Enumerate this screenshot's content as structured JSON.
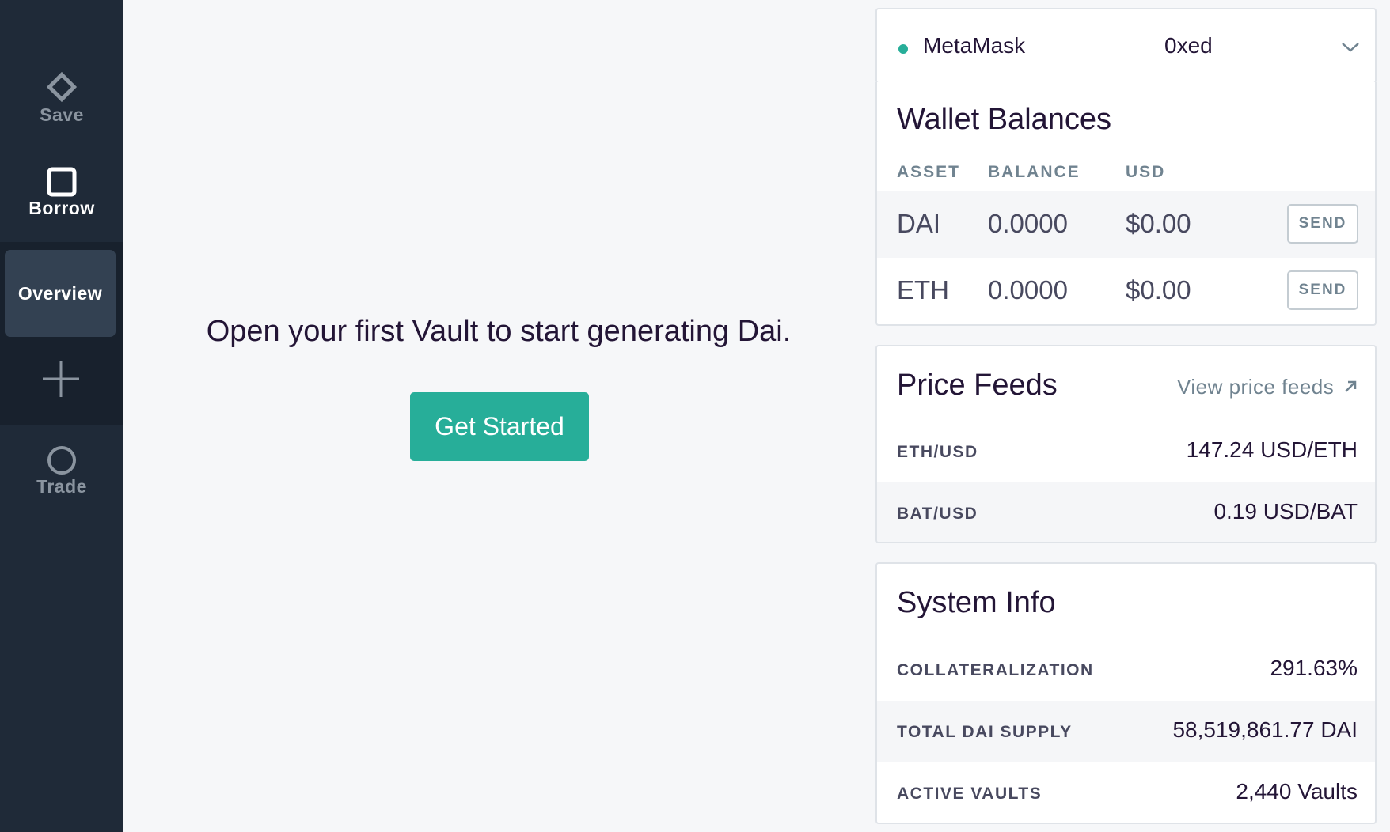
{
  "sidebar": {
    "save_label": "Save",
    "borrow_label": "Borrow",
    "overview_label": "Overview",
    "trade_label": "Trade"
  },
  "main": {
    "message": "Open your first Vault to start generating Dai.",
    "cta_label": "Get Started"
  },
  "account": {
    "provider": "MetaMask",
    "address": "0xed",
    "status_color": "#27ae99"
  },
  "wallet": {
    "title": "Wallet Balances",
    "columns": [
      "ASSET",
      "BALANCE",
      "USD"
    ],
    "rows": [
      {
        "asset": "DAI",
        "balance": "0.0000",
        "usd": "$0.00",
        "action": "SEND"
      },
      {
        "asset": "ETH",
        "balance": "0.0000",
        "usd": "$0.00",
        "action": "SEND"
      }
    ]
  },
  "price_feeds": {
    "title": "Price Feeds",
    "link_label": "View price feeds",
    "rows": [
      {
        "pair": "ETH/USD",
        "value": "147.24 USD/ETH"
      },
      {
        "pair": "BAT/USD",
        "value": "0.19 USD/BAT"
      }
    ]
  },
  "system_info": {
    "title": "System Info",
    "rows": [
      {
        "label": "COLLATERALIZATION",
        "value": "291.63%"
      },
      {
        "label": "TOTAL DAI SUPPLY",
        "value": "58,519,861.77 DAI"
      },
      {
        "label": "ACTIVE VAULTS",
        "value": "2,440 Vaults"
      }
    ]
  },
  "colors": {
    "accent": "#27ae99",
    "sidebar_bg": "#1f2a38",
    "text_primary": "#231536"
  }
}
